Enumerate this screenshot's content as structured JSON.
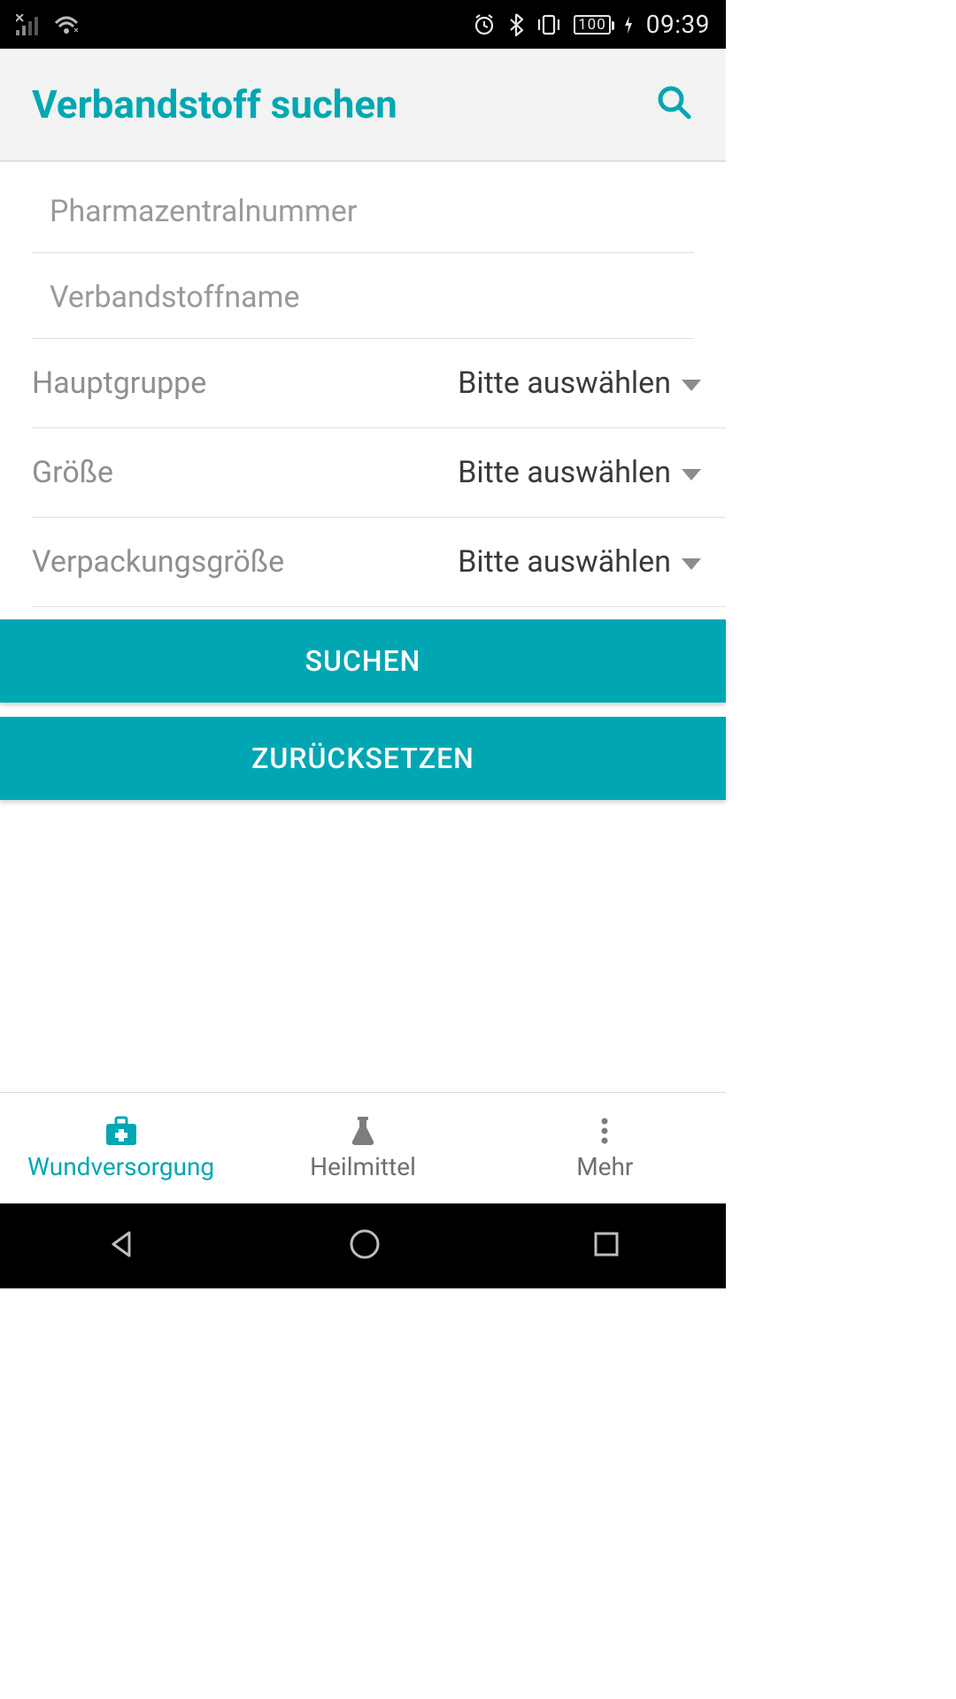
{
  "status_bar": {
    "time": "09:39",
    "battery_text": "100"
  },
  "app_bar": {
    "title": "Verbandstoff suchen"
  },
  "form": {
    "pharma_placeholder": "Pharmazentralnummer",
    "name_placeholder": "Verbandstoffname",
    "selects": [
      {
        "label": "Hauptgruppe",
        "value": "Bitte auswählen"
      },
      {
        "label": "Größe",
        "value": "Bitte auswählen"
      },
      {
        "label": "Verpackungsgröße",
        "value": "Bitte auswählen"
      }
    ],
    "search_button": "SUCHEN",
    "reset_button": "ZURÜCKSETZEN"
  },
  "bottom_nav": {
    "items": [
      {
        "label": "Wundversorgung"
      },
      {
        "label": "Heilmittel"
      },
      {
        "label": "Mehr"
      }
    ]
  }
}
